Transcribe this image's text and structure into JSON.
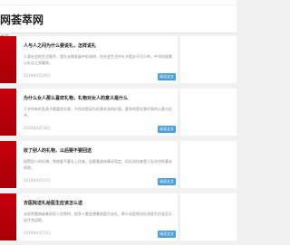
{
  "site": {
    "title": "网荟萃网",
    "breadcrumb": "首页"
  },
  "articles": [
    {
      "title": "人与人之间为什么要说礼，怎样说礼",
      "summary": "人类社会的生活秩序，是在长期发展中形成的，在社会生活中礼节是必不可少的，中华民族素以礼仪之邦著称。",
      "date": "2019年4月26日",
      "button": "阅读全文"
    },
    {
      "title": "为什么女人那么喜欢礼物，礼物对女人的意义是什么",
      "summary": "几乎所有的女孩子都喜欢礼物，不仅仅是因为礼物本身的价值，更多的是礼物代表的心意与在乎。",
      "date": "2019年4月18日",
      "button": "阅读全文"
    },
    {
      "title": "收了别人的礼物，以后要不要回送",
      "summary": "接受别人的礼物，到底要不要礼上往来，这要看具体情况而定，但礼尚往来是人际交往的基本原则。",
      "date": "2019年4月17日",
      "button": "阅读全文"
    },
    {
      "title": "去医院送礼给医生应该怎么送",
      "summary": "去医院看病或者陪家人住院时，很多人都会想着给医生送礼，那么去医院送礼给医生应该怎么送才合适呢。",
      "date": "2019年4月15日",
      "button": "阅读全文"
    }
  ]
}
